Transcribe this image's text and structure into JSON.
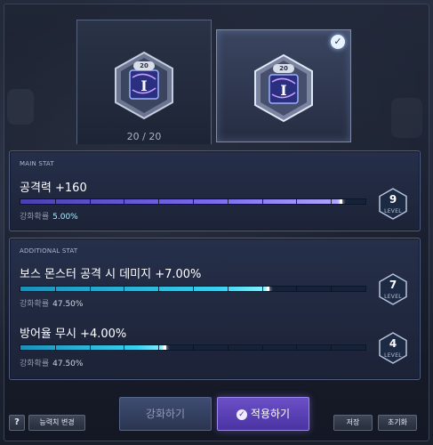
{
  "items": {
    "left": {
      "level_tag": "20",
      "count": "20 / 20"
    },
    "right": {
      "level_tag": "20",
      "selected": true
    }
  },
  "main_stat": {
    "header": "MAIN STAT",
    "name": "공격력 +160",
    "progress": 0.93,
    "prob_label": "강화확률",
    "prob_value": "5.00%",
    "level": "9",
    "level_label": "LEVEL"
  },
  "additional_stat": {
    "header": "ADDITIONAL STAT",
    "rows": [
      {
        "name": "보스 몬스터 공격 시 데미지 +7.00%",
        "progress": 0.72,
        "prob_label": "강화확률",
        "prob_value": "47.50%",
        "level": "7",
        "level_label": "LEVEL"
      },
      {
        "name": "방어율 무시 +4.00%",
        "progress": 0.42,
        "prob_label": "강화확률",
        "prob_value": "47.50%",
        "level": "4",
        "level_label": "LEVEL"
      }
    ]
  },
  "buttons": {
    "help": "?",
    "change_stat": "능력치 변경",
    "enhance": "강화하기",
    "apply": "적용하기",
    "save": "저장",
    "reset": "초기화"
  },
  "colors": {
    "main_bar": "#7a6af0",
    "additional_bar": "#3ad0ee",
    "apply_button": "#6b4fc7",
    "enhance_button": "#3f4d72"
  }
}
